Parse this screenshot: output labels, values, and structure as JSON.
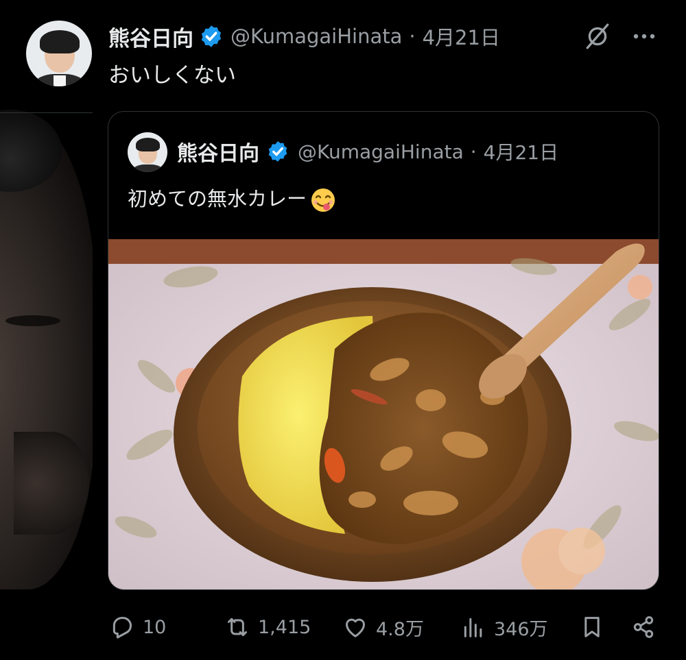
{
  "tweet": {
    "display_name": "熊谷日向",
    "handle": "@KumagaiHinata",
    "separator": "·",
    "date": "4月21日",
    "text": "おいしくない"
  },
  "quoted_tweet": {
    "display_name": "熊谷日向",
    "handle": "@KumagaiHinata",
    "separator": "·",
    "date": "4月21日",
    "text": "初めての無水カレー",
    "emoji": "face-savoring-food"
  },
  "actions": {
    "replies": "10",
    "retweets": "1,415",
    "likes": "4.8万",
    "views": "346万"
  },
  "icons": {
    "verified": "verified-badge-icon",
    "grok": "grok-icon",
    "more": "more-icon",
    "reply": "reply-icon",
    "retweet": "retweet-icon",
    "like": "heart-icon",
    "views": "views-icon",
    "bookmark": "bookmark-icon",
    "share": "share-icon"
  },
  "colors": {
    "background": "#000000",
    "text_primary": "#e7e9ea",
    "text_secondary": "#9a9fa4",
    "verified_blue": "#1d9bf0",
    "border": "#2f3336"
  }
}
